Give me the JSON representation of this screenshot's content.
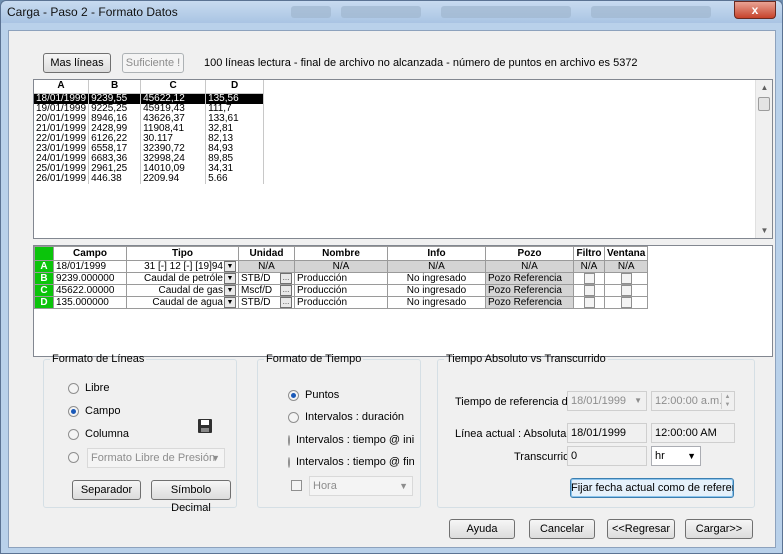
{
  "window": {
    "title": "Carga - Paso 2 - Formato Datos",
    "close_glyph": "x"
  },
  "toolbar": {
    "more_lines": "Mas líneas",
    "enough": "Suficiente !",
    "status": "100 líneas lectura - final de archivo no alcanzada - número de puntos en archivo es 5372"
  },
  "raw_table": {
    "headers": [
      "A",
      "B",
      "C",
      "D"
    ],
    "rows": [
      [
        "18/01/1999",
        "9239,55",
        "45622,12",
        "135,56"
      ],
      [
        "19/01/1999",
        "9225,25",
        "45919,43",
        "111,7"
      ],
      [
        "20/01/1999",
        "8946,16",
        "43626,37",
        "133,61"
      ],
      [
        "21/01/1999",
        "2428,99",
        "11908,41",
        "32,81"
      ],
      [
        "22/01/1999",
        "6126,22",
        "30.117",
        "82,13"
      ],
      [
        "23/01/1999",
        "6558,17",
        "32390,72",
        "84,93"
      ],
      [
        "24/01/1999",
        "6683,36",
        "32998,24",
        "89,85"
      ],
      [
        "25/01/1999",
        "2961,25",
        "14010,09",
        "34,31"
      ],
      [
        "26/01/1999",
        "446.38",
        "2209.94",
        "5.66"
      ]
    ]
  },
  "map_table": {
    "headers": [
      "Campo",
      "Tipo",
      "Unidad",
      "Nombre",
      "Info",
      "Pozo",
      "Filtro",
      "Ventana"
    ],
    "rows": [
      {
        "letter": "A",
        "campo": "18/01/1999",
        "tipo": "31 [-] 12 [-] [19]94",
        "unidad": "N/A",
        "nombre": "N/A",
        "info": "N/A",
        "pozo": "N/A",
        "filtro": "N/A",
        "ventana": "N/A"
      },
      {
        "letter": "B",
        "campo": "9239.000000",
        "tipo": "Caudal  de petróle",
        "unidad": "STB/D",
        "nombre": "Producción",
        "info": "No ingresado",
        "pozo": "Pozo Referencia"
      },
      {
        "letter": "C",
        "campo": "45622.00000",
        "tipo": "Caudal  de gas",
        "unidad": "Mscf/D",
        "nombre": "Producción",
        "info": "No ingresado",
        "pozo": "Pozo Referencia"
      },
      {
        "letter": "D",
        "campo": "135.000000",
        "tipo": "Caudal de agua",
        "unidad": "STB/D",
        "nombre": "Producción",
        "info": "No ingresado",
        "pozo": "Pozo Referencia"
      }
    ]
  },
  "line_format": {
    "legend": "Formato de Líneas",
    "options": [
      "Libre",
      "Campo",
      "Columna"
    ],
    "selected": "Campo",
    "pressure_select": "Formato Libre de Presión",
    "separator_btn": "Separador",
    "decimal_btn": "Símbolo Decimal"
  },
  "time_format": {
    "legend": "Formato de Tiempo",
    "options": [
      "Puntos",
      "Intervalos : duración",
      "Intervalos : tiempo @ inic",
      "Intervalos : tiempo @ fina"
    ],
    "selected": "Puntos",
    "unit_select": "Hora"
  },
  "abs_time": {
    "legend": "Tiempo Absoluto vs Transcurrido",
    "ref_label": "Tiempo de referencia del",
    "ref_date": "18/01/1999",
    "ref_time": "12:00:00 a.m.",
    "current_label": "Línea actual :  Absoluta",
    "current_date": "18/01/1999",
    "current_time": "12:00:00 AM",
    "elapsed_label": "Transcurrido",
    "elapsed_value": "0",
    "unit": "hr",
    "set_btn": "Fijar fecha actual como de referencia"
  },
  "footer": {
    "help": "Ayuda",
    "cancel": "Cancelar",
    "back": "<<Regresar",
    "load": "Cargar>>"
  }
}
